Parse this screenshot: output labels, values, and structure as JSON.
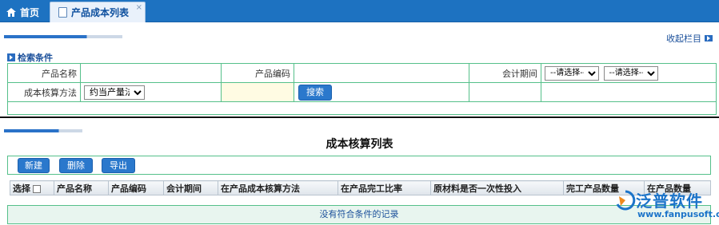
{
  "tabs": [
    {
      "label": "首页",
      "icon": "home-icon"
    },
    {
      "label": "产品成本列表",
      "icon": "document-icon"
    }
  ],
  "tab_close": "×",
  "collapse_label": "收起栏目",
  "search": {
    "title": "检索条件",
    "product_name_label": "产品名称",
    "product_code_label": "产品编码",
    "period_label": "会计期间",
    "period_select_1": "--请选择--",
    "period_select_2": "--请选择--",
    "method_label": "成本核算方法",
    "method_value": "约当产量法",
    "search_button": "搜索"
  },
  "list": {
    "title": "成本核算列表",
    "buttons": {
      "new": "新建",
      "delete": "删除",
      "export": "导出"
    },
    "columns": [
      "选择",
      "产品名称",
      "产品编码",
      "会计期间",
      "在产品成本核算方法",
      "在产品完工比率",
      "原材料是否一次性投入",
      "完工产品数量",
      "在产品数量"
    ],
    "empty_message": "没有符合条件的记录"
  },
  "logo": {
    "name": "泛普软件",
    "url": "www.fanpusoft.com"
  },
  "colors": {
    "tabbar": "#1d72c1",
    "accent": "#2a78cc",
    "border_green": "#55c08a"
  }
}
